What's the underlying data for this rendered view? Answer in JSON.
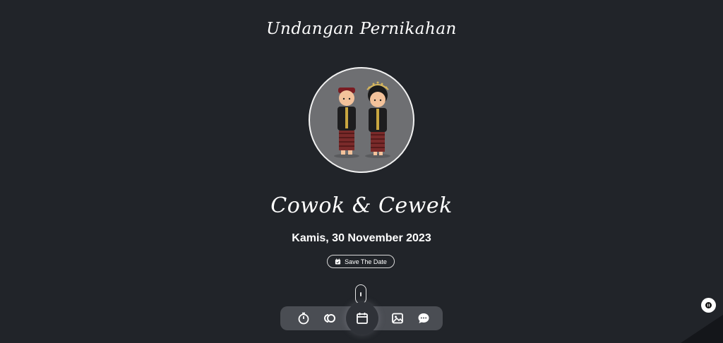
{
  "header": {
    "title": "Undangan Pernikahan"
  },
  "couple": {
    "names": "Cowok & Cewek"
  },
  "event": {
    "date": "Kamis, 30 November 2023"
  },
  "save_button": {
    "label": "Save The Date",
    "icon": "calendar-check-icon"
  },
  "navbar": {
    "items": [
      {
        "icon": "stopwatch-icon",
        "active": false
      },
      {
        "icon": "couple-icon",
        "active": false
      },
      {
        "icon": "calendar-icon",
        "active": true
      },
      {
        "icon": "gallery-icon",
        "active": false
      },
      {
        "icon": "chat-icon",
        "active": false
      }
    ]
  },
  "music_button": {
    "icon": "pause-icon",
    "playing": true
  },
  "colors": {
    "background": "#212429",
    "navbar": "#4a4d53",
    "nav_active": "#2f3238",
    "avatar_bg": "#6e6f72",
    "text": "#ffffff"
  }
}
